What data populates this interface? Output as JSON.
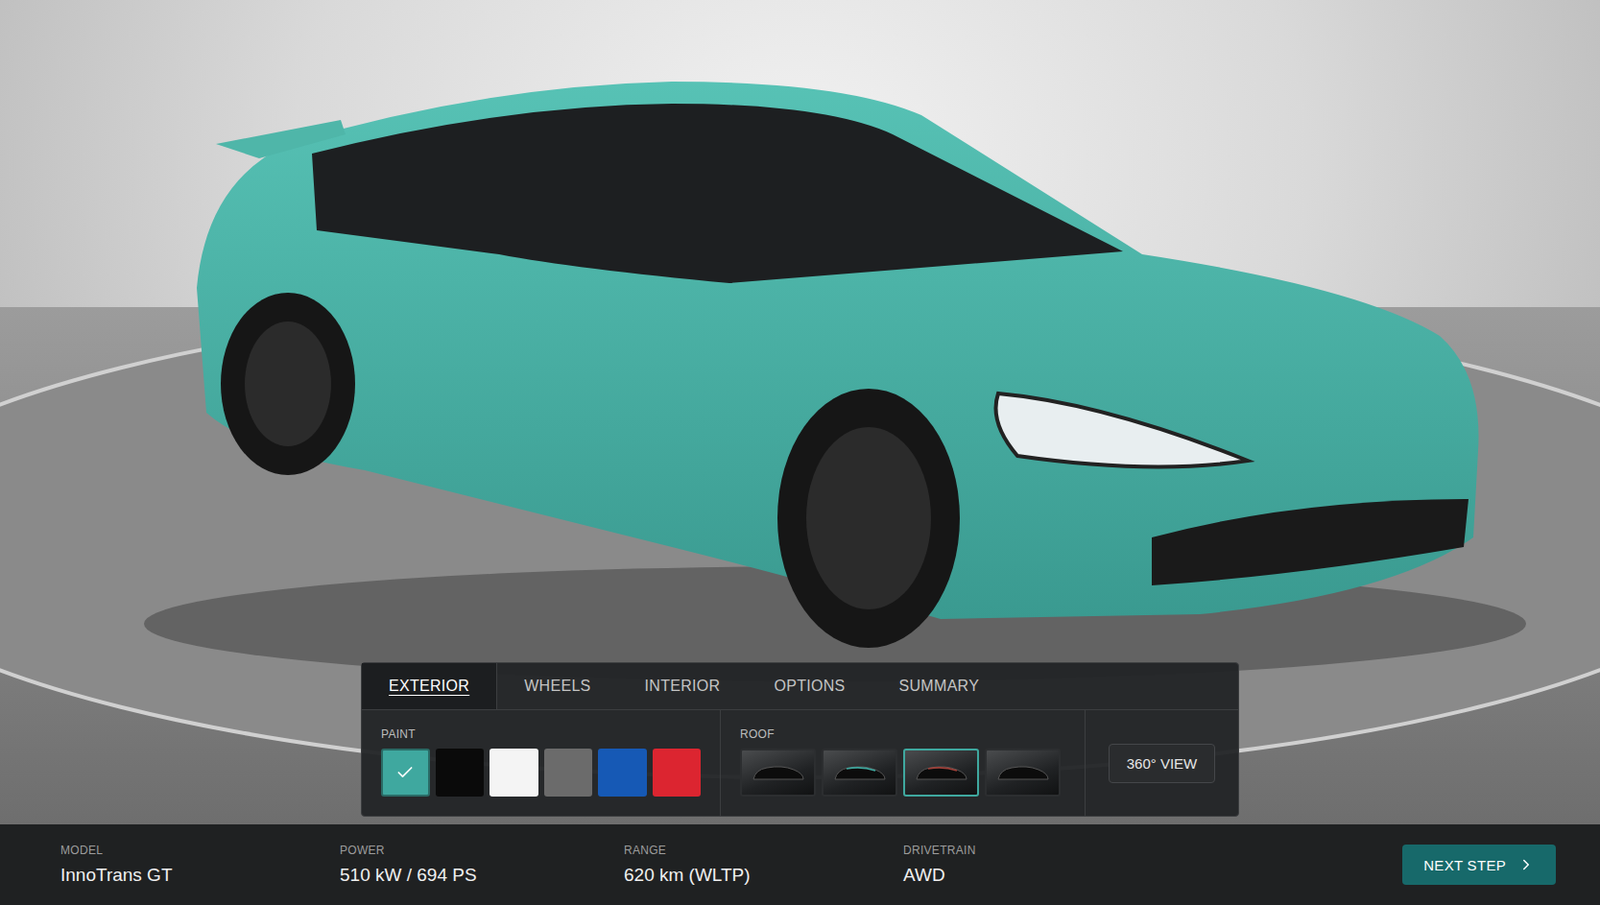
{
  "tabs": [
    {
      "label": "EXTERIOR",
      "selected": true
    },
    {
      "label": "WHEELS",
      "selected": false
    },
    {
      "label": "INTERIOR",
      "selected": false
    },
    {
      "label": "OPTIONS",
      "selected": false
    },
    {
      "label": "SUMMARY",
      "selected": false
    }
  ],
  "paint": {
    "label": "PAINT",
    "swatches": [
      {
        "color": "#3fa89f",
        "selected": true
      },
      {
        "color": "#0a0a0a",
        "selected": false
      },
      {
        "color": "#f4f4f4",
        "selected": false
      },
      {
        "color": "#6b6b6b",
        "selected": false
      },
      {
        "color": "#1659b5",
        "selected": false
      },
      {
        "color": "#dc2530",
        "selected": false
      }
    ]
  },
  "roof": {
    "label": "ROOF",
    "options": [
      {
        "selected": false
      },
      {
        "selected": false
      },
      {
        "selected": true
      },
      {
        "selected": false
      }
    ]
  },
  "view_button": "360° VIEW",
  "specs": [
    {
      "label": "MODEL",
      "value": "InnoTrans GT"
    },
    {
      "label": "POWER",
      "value": "510 kW / 694 PS"
    },
    {
      "label": "RANGE",
      "value": "620 km (WLTP)"
    },
    {
      "label": "DRIVETRAIN",
      "value": "AWD"
    }
  ],
  "next_button": "NEXT STEP"
}
